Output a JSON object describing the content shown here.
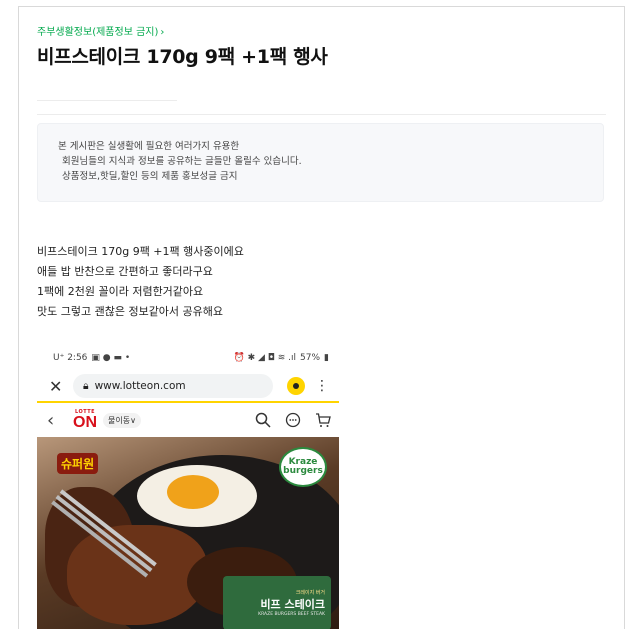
{
  "board": {
    "link_label": "주부생활정보(제품정보 금지)",
    "chevron": "›"
  },
  "post": {
    "title": "비프스테이크 170g 9팩 +1팩 행사"
  },
  "notice": {
    "lines": [
      "본 게시판은 실생활에 필요한 여러가지 유용한",
      "회원님들의 지식과 정보를 공유하는 글들만 올릴수 있습니다.",
      "상품정보,핫딜,할인 등의 제품 홍보성글 금지"
    ]
  },
  "body": {
    "lines": [
      "비프스테이크 170g 9팩 +1팩 행사중이에요",
      "애들 밥 반찬으로 간편하고 좋더라구요",
      "1팩에 2천원 꼴이라 저렴한거같아요",
      "맛도 그렇고 괜찮은 정보같아서 공유해요"
    ]
  },
  "screenshot": {
    "status_time": "U⁺ 2:56",
    "status_icons_left": "▣ ● ▬ •",
    "status_icons_right": "⏰ ✱ ◢ ◘ ≋ .ıl",
    "battery": "57%",
    "url": "www.lotteon.com",
    "logo_top": "LOTTE",
    "logo_main": "ON",
    "location": "물이동∨",
    "badge_left": "슈퍼원",
    "badge_right_1": "Kraze",
    "badge_right_2": "burgers",
    "pack_sub": "크레이지 버거",
    "pack_name": "비프 스테이크",
    "pack_eng": "KRAZE BURGERS BEEF STEAK"
  },
  "colors": {
    "accent_green": "#03a94d",
    "lotte_red": "#d8101b",
    "kakao_yellow": "#ffd400"
  }
}
